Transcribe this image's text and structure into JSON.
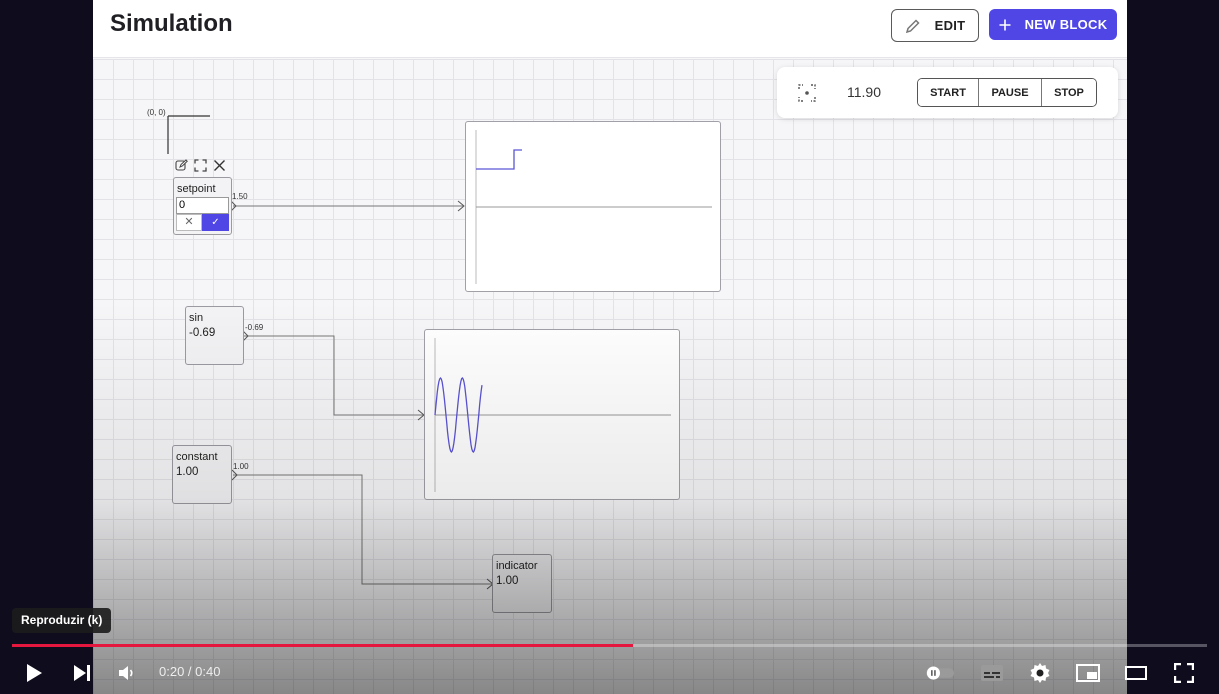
{
  "header": {
    "title": "Simulation",
    "edit_label": "EDIT",
    "new_block_label": "NEW BLOCK",
    "accent_color": "#4f46e5"
  },
  "sim_panel": {
    "time": "11.90",
    "start_label": "START",
    "pause_label": "PAUSE",
    "stop_label": "STOP",
    "focus_icon": "focus-center-icon"
  },
  "canvas": {
    "origin_label": "(0, 0)",
    "blocks": {
      "setpoint": {
        "name": "setpoint",
        "input_value": "0",
        "output_label": "1.50"
      },
      "sin": {
        "name": "sin",
        "value": "-0.69",
        "output_label": "-0.69"
      },
      "constant": {
        "name": "constant",
        "value": "1.00",
        "output_label": "1.00"
      },
      "indicator": {
        "name": "indicator",
        "value": "1.00"
      }
    },
    "setpoint_editor": {
      "cancel_glyph": "✕",
      "confirm_glyph": "✓",
      "tools": [
        "edit-icon",
        "expand-icon",
        "close-icon"
      ]
    },
    "trace_color": "#5b54d6"
  },
  "player": {
    "tooltip": "Reproduzir (k)",
    "current_time": "0:20",
    "duration": "0:40",
    "time_display": "0:20 / 0:40",
    "progress_fraction": 0.52,
    "progress_color": "#e6173e"
  }
}
